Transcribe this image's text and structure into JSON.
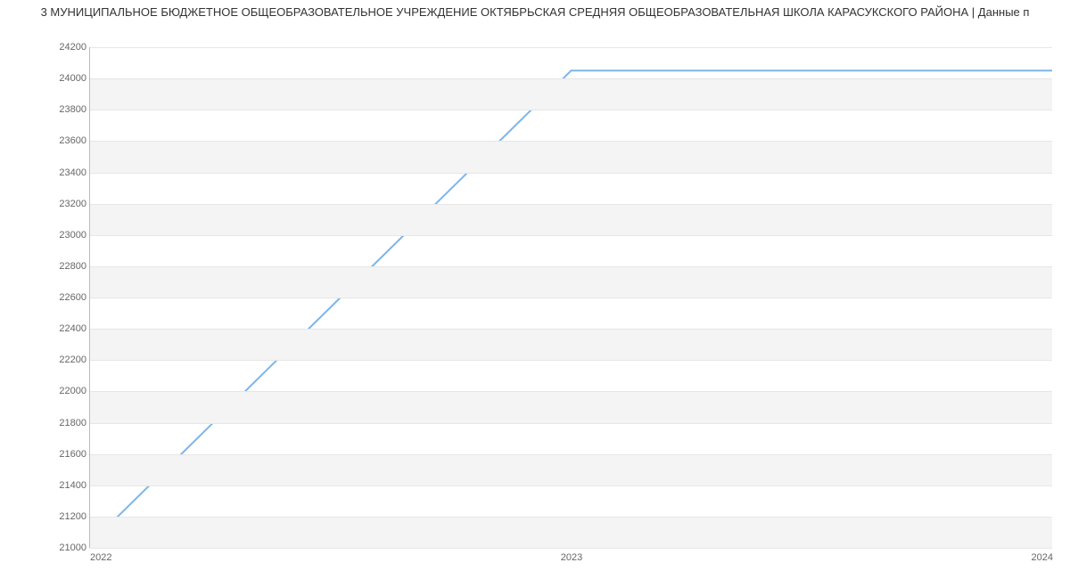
{
  "title": "3 МУНИЦИПАЛЬНОЕ БЮДЖЕТНОЕ ОБЩЕОБРАЗОВАТЕЛЬНОЕ УЧРЕЖДЕНИЕ ОКТЯБРЬСКАЯ СРЕДНЯЯ ОБЩЕОБРАЗОВАТЕЛЬНАЯ ШКОЛА КАРАСУКСКОГО РАЙОНА | Данные п",
  "chart_data": {
    "type": "line",
    "x": [
      2022,
      2023,
      2024
    ],
    "values": [
      21020,
      24050,
      24050
    ],
    "xlabel": "",
    "ylabel": "",
    "xlim": [
      2022,
      2024
    ],
    "ylim": [
      21000,
      24200
    ],
    "y_ticks": [
      21000,
      21200,
      21400,
      21600,
      21800,
      22000,
      22200,
      22400,
      22600,
      22800,
      23000,
      23200,
      23400,
      23600,
      23800,
      24000,
      24200
    ],
    "x_ticks": [
      2022,
      2023,
      2024
    ]
  }
}
